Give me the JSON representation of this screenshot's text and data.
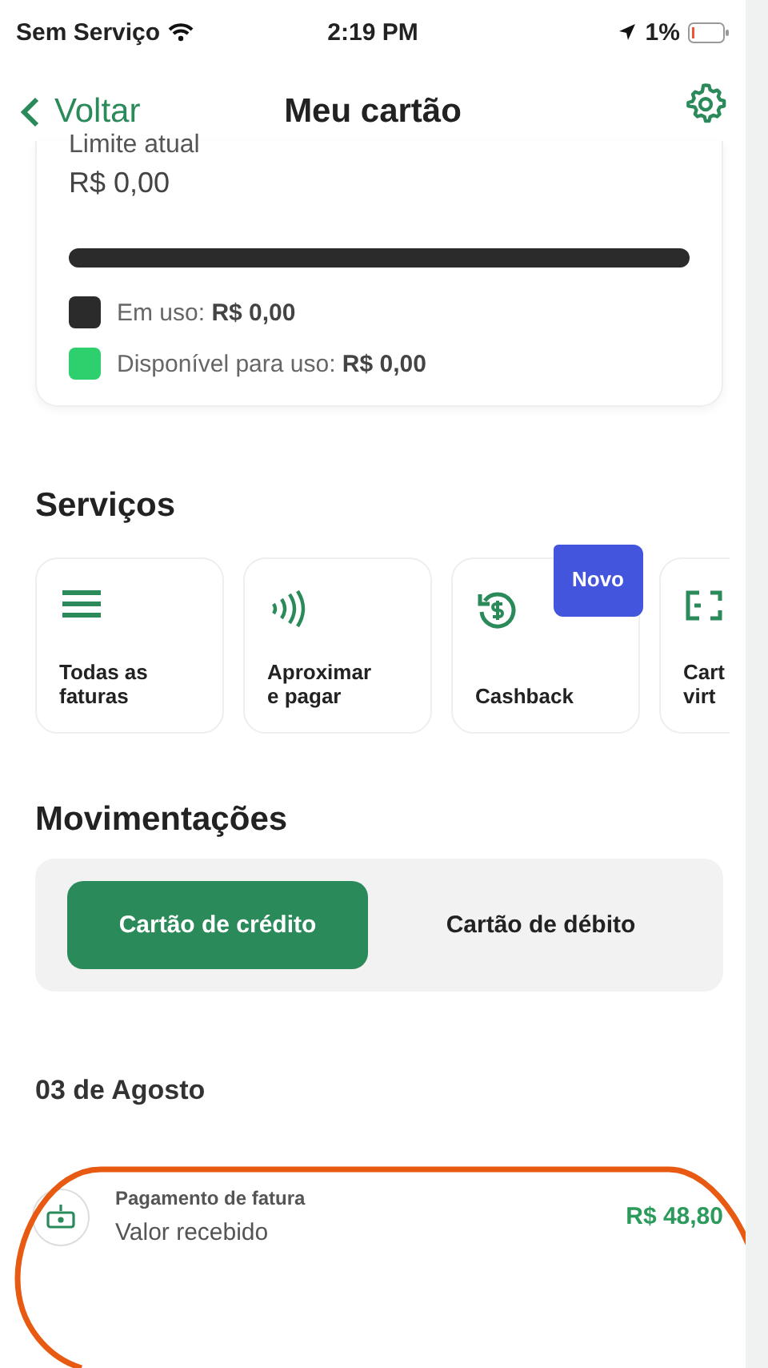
{
  "status_bar": {
    "carrier": "Sem Serviço",
    "time": "2:19 PM",
    "battery": "1%"
  },
  "header": {
    "back": "Voltar",
    "title": "Meu cartão"
  },
  "limit_card": {
    "label": "Limite atual",
    "value": "R$ 0,00",
    "legend": [
      {
        "label": "Em uso:",
        "value": "R$ 0,00",
        "color": "#2b2b2b"
      },
      {
        "label": "Disponível para uso:",
        "value": "R$ 0,00",
        "color": "#2ed06e"
      }
    ]
  },
  "services": {
    "title": "Serviços",
    "items": [
      {
        "kind": "list",
        "label": "Todas as\nfaturas"
      },
      {
        "kind": "contactless",
        "label": "Aproximar\ne pagar"
      },
      {
        "kind": "cashback",
        "label": "Cashback",
        "badge": "Novo"
      },
      {
        "kind": "card",
        "label": "Cart\nvirt"
      }
    ]
  },
  "movements": {
    "title": "Movimentações",
    "tabs": [
      {
        "label": "Cartão de crédito",
        "selected": true
      },
      {
        "label": "Cartão de débito",
        "selected": false
      }
    ],
    "date": "03 de Agosto",
    "transactions": [
      {
        "title": "Pagamento de fatura",
        "subtitle": "Valor recebido",
        "amount": "R$ 48,80"
      }
    ]
  }
}
